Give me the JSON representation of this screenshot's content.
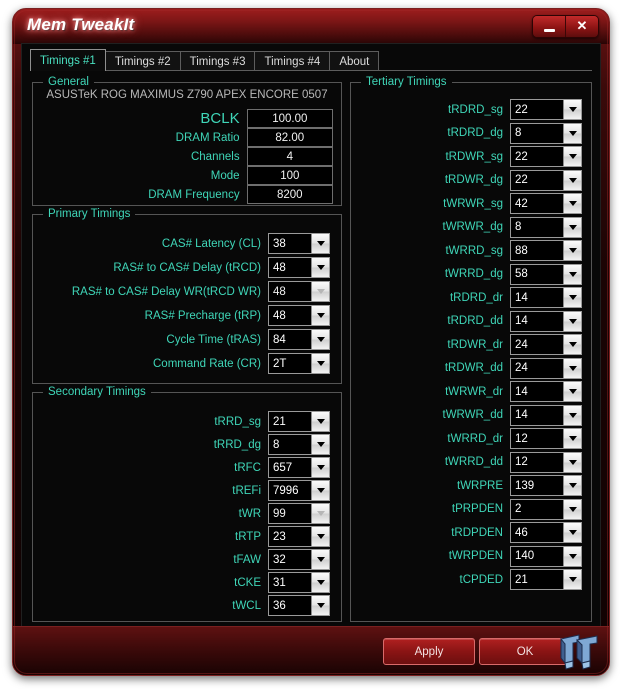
{
  "window": {
    "title": "Mem TweakIt",
    "minimize_label": "minimize",
    "close_label": "close"
  },
  "tabs": [
    {
      "label": "Timings #1",
      "active": true
    },
    {
      "label": "Timings #2",
      "active": false
    },
    {
      "label": "Timings #3",
      "active": false
    },
    {
      "label": "Timings #4",
      "active": false
    },
    {
      "label": "About",
      "active": false
    }
  ],
  "general": {
    "legend": "General",
    "motherboard": "ASUSTeK ROG MAXIMUS Z790 APEX ENCORE 0507",
    "fields": [
      {
        "label": "BCLK",
        "value": "100.00",
        "big": true
      },
      {
        "label": "DRAM Ratio",
        "value": "82.00",
        "big": false
      },
      {
        "label": "Channels",
        "value": "4",
        "big": false
      },
      {
        "label": "Mode",
        "value": "100",
        "big": false
      },
      {
        "label": "DRAM Frequency",
        "value": "8200",
        "big": false
      }
    ]
  },
  "primary": {
    "legend": "Primary Timings",
    "fields": [
      {
        "label": "CAS# Latency (CL)",
        "value": "38",
        "disabled": false
      },
      {
        "label": "RAS# to CAS# Delay (tRCD)",
        "value": "48",
        "disabled": false
      },
      {
        "label": "RAS# to CAS# Delay WR(tRCD WR)",
        "value": "48",
        "disabled": true
      },
      {
        "label": "RAS# Precharge (tRP)",
        "value": "48",
        "disabled": false
      },
      {
        "label": "Cycle Time (tRAS)",
        "value": "84",
        "disabled": false
      },
      {
        "label": "Command Rate (CR)",
        "value": "2T",
        "disabled": false
      }
    ]
  },
  "secondary": {
    "legend": "Secondary Timings",
    "fields": [
      {
        "label": "tRRD_sg",
        "value": "21",
        "disabled": false
      },
      {
        "label": "tRRD_dg",
        "value": "8",
        "disabled": false
      },
      {
        "label": "tRFC",
        "value": "657",
        "disabled": false
      },
      {
        "label": "tREFi",
        "value": "7996",
        "disabled": false
      },
      {
        "label": "tWR",
        "value": "99",
        "disabled": true
      },
      {
        "label": "tRTP",
        "value": "23",
        "disabled": false
      },
      {
        "label": "tFAW",
        "value": "32",
        "disabled": false
      },
      {
        "label": "tCKE",
        "value": "31",
        "disabled": false
      },
      {
        "label": "tWCL",
        "value": "36",
        "disabled": false
      }
    ]
  },
  "tertiary": {
    "legend": "Tertiary Timings",
    "fields": [
      {
        "label": "tRDRD_sg",
        "value": "22",
        "disabled": false
      },
      {
        "label": "tRDRD_dg",
        "value": "8",
        "disabled": false
      },
      {
        "label": "tRDWR_sg",
        "value": "22",
        "disabled": false
      },
      {
        "label": "tRDWR_dg",
        "value": "22",
        "disabled": false
      },
      {
        "label": "tWRWR_sg",
        "value": "42",
        "disabled": false
      },
      {
        "label": "tWRWR_dg",
        "value": "8",
        "disabled": false
      },
      {
        "label": "tWRRD_sg",
        "value": "88",
        "disabled": false
      },
      {
        "label": "tWRRD_dg",
        "value": "58",
        "disabled": false
      },
      {
        "label": "tRDRD_dr",
        "value": "14",
        "disabled": false
      },
      {
        "label": "tRDRD_dd",
        "value": "14",
        "disabled": false
      },
      {
        "label": "tRDWR_dr",
        "value": "24",
        "disabled": false
      },
      {
        "label": "tRDWR_dd",
        "value": "24",
        "disabled": false
      },
      {
        "label": "tWRWR_dr",
        "value": "14",
        "disabled": false
      },
      {
        "label": "tWRWR_dd",
        "value": "14",
        "disabled": false
      },
      {
        "label": "tWRRD_dr",
        "value": "12",
        "disabled": false
      },
      {
        "label": "tWRRD_dd",
        "value": "12",
        "disabled": false
      },
      {
        "label": "tWRPRE",
        "value": "139",
        "disabled": false
      },
      {
        "label": "tPRPDEN",
        "value": "2",
        "disabled": false
      },
      {
        "label": "tRDPDEN",
        "value": "46",
        "disabled": false
      },
      {
        "label": "tWRPDEN",
        "value": "140",
        "disabled": false
      },
      {
        "label": "tCPDED",
        "value": "21",
        "disabled": false
      }
    ]
  },
  "footer": {
    "apply_label": "Apply",
    "ok_label": "OK",
    "logo": "tweaktown-tt-logo"
  },
  "colors": {
    "accent_label": "#3fd6b8",
    "window_red": "#8a1414",
    "active_tab_text": "#49e0c0"
  }
}
